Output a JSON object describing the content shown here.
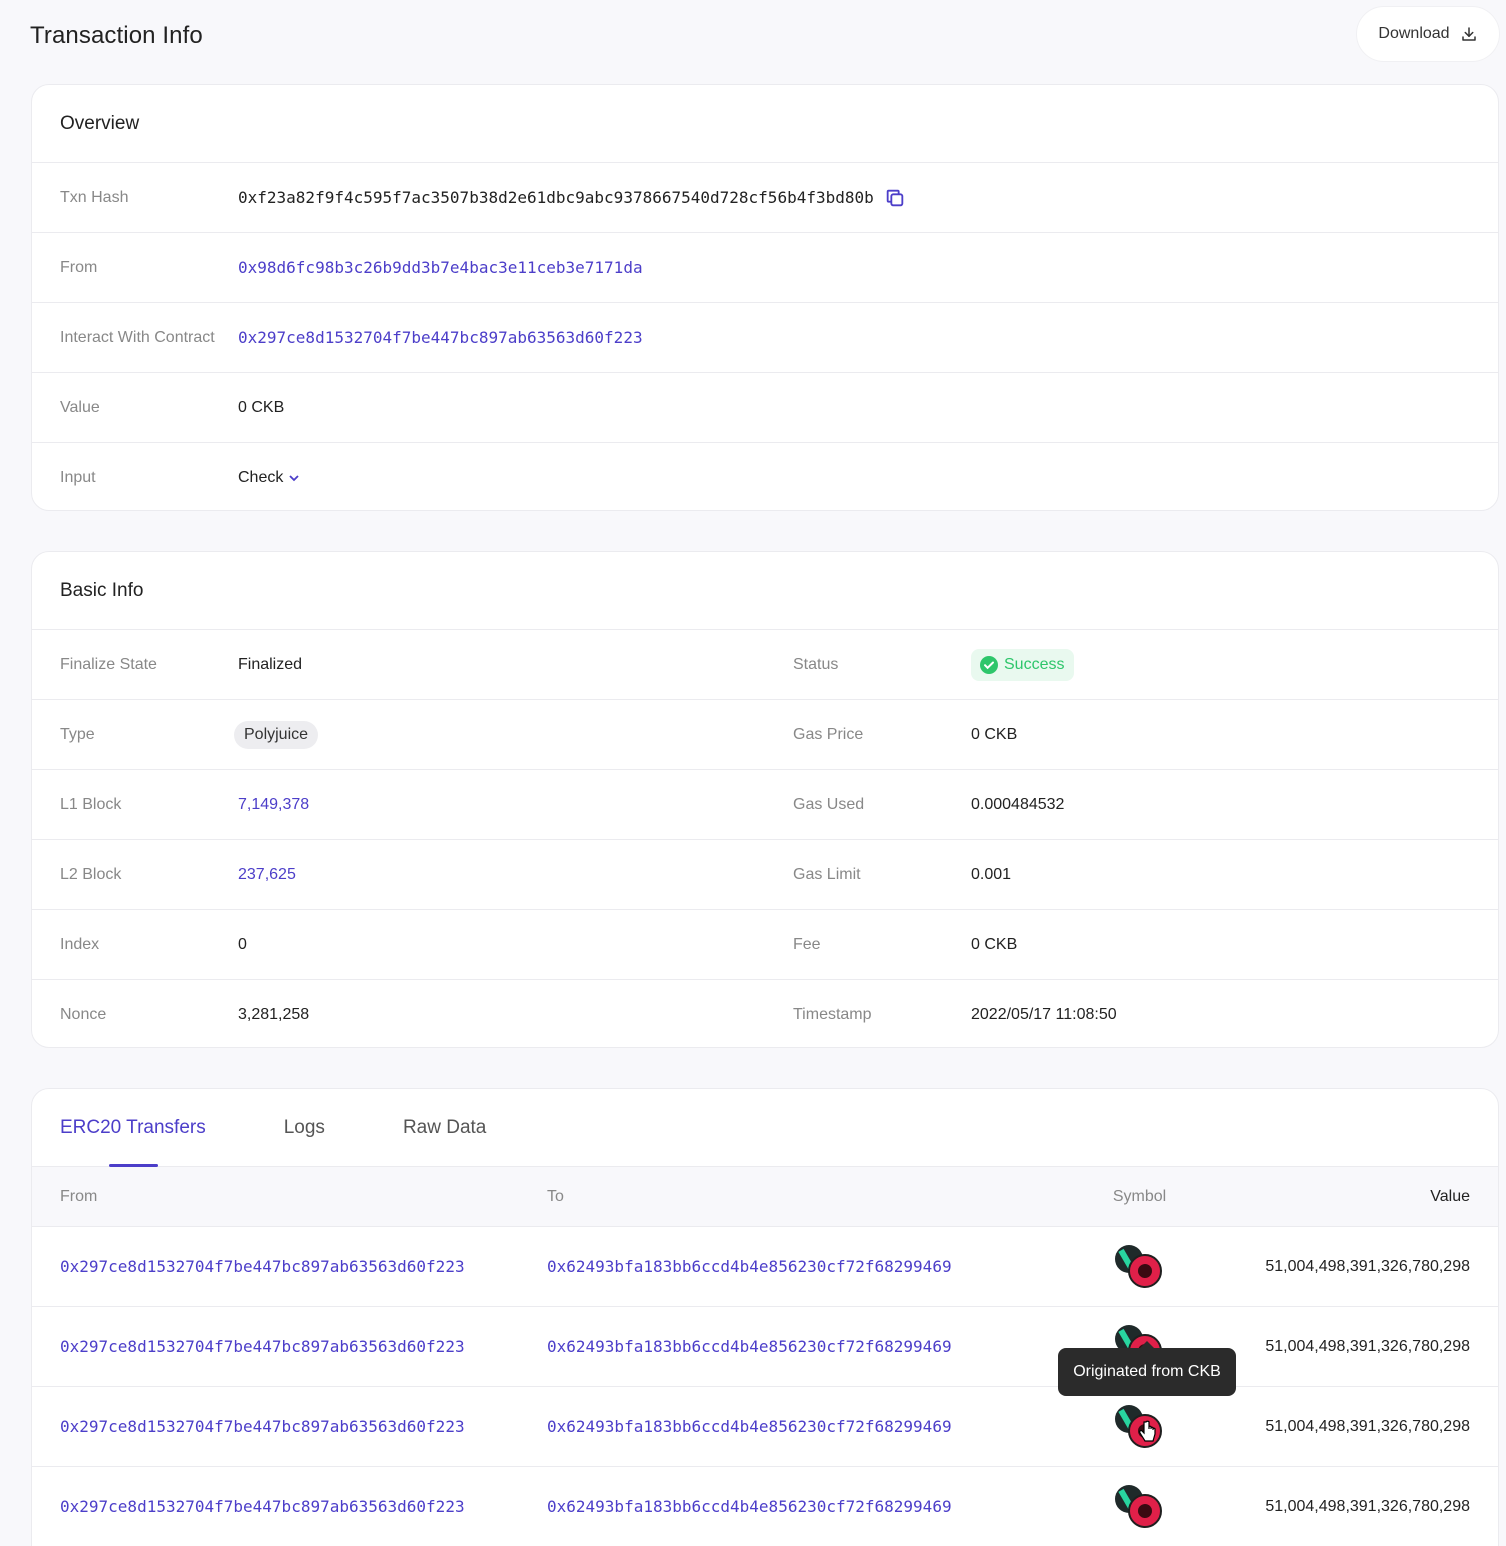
{
  "header": {
    "title": "Transaction Info",
    "download_label": "Download"
  },
  "overview": {
    "title": "Overview",
    "rows": {
      "txn_hash": {
        "label": "Txn Hash",
        "value": "0xf23a82f9f4c595f7ac3507b38d2e61dbc9abc9378667540d728cf56b4f3bd80b"
      },
      "from": {
        "label": "From",
        "value": "0x98d6fc98b3c26b9dd3b7e4bac3e11ceb3e7171da"
      },
      "contract": {
        "label": "Interact With Contract",
        "value": "0x297ce8d1532704f7be447bc897ab63563d60f223"
      },
      "value": {
        "label": "Value",
        "value": "0 CKB"
      },
      "input": {
        "label": "Input",
        "value": "Check"
      }
    }
  },
  "basic_info": {
    "title": "Basic Info",
    "left": [
      {
        "label": "Finalize State",
        "value": "Finalized"
      },
      {
        "label": "Type",
        "value": "Polyjuice"
      },
      {
        "label": "L1 Block",
        "value": "7,149,378"
      },
      {
        "label": "L2 Block",
        "value": "237,625"
      },
      {
        "label": "Index",
        "value": "0"
      },
      {
        "label": "Nonce",
        "value": "3,281,258"
      }
    ],
    "right": [
      {
        "label": "Status",
        "value": "Success"
      },
      {
        "label": "Gas Price",
        "value": "0 CKB"
      },
      {
        "label": "Gas Used",
        "value": "0.000484532"
      },
      {
        "label": "Gas Limit",
        "value": "0.001"
      },
      {
        "label": "Fee",
        "value": "0 CKB"
      },
      {
        "label": "Timestamp",
        "value": "2022/05/17 11:08:50"
      }
    ],
    "status_color": "#2ec66b"
  },
  "transfers": {
    "tabs": [
      {
        "label": "ERC20 Transfers",
        "active": true
      },
      {
        "label": "Logs",
        "active": false
      },
      {
        "label": "Raw Data",
        "active": false
      }
    ],
    "columns": {
      "from": "From",
      "to": "To",
      "symbol": "Symbol",
      "value": "Value"
    },
    "rows": [
      {
        "from": "0x297ce8d1532704f7be447bc897ab63563d60f223",
        "to": "0x62493bfa183bb6ccd4b4e856230cf72f68299469",
        "symbol_icon": "token-pair-icon",
        "value": "51,004,498,391,326,780,298"
      },
      {
        "from": "0x297ce8d1532704f7be447bc897ab63563d60f223",
        "to": "0x62493bfa183bb6ccd4b4e856230cf72f68299469",
        "symbol_icon": "token-pair-icon",
        "value": "51,004,498,391,326,780,298"
      },
      {
        "from": "0x297ce8d1532704f7be447bc897ab63563d60f223",
        "to": "0x62493bfa183bb6ccd4b4e856230cf72f68299469",
        "symbol_icon": "token-pair-icon",
        "value": "51,004,498,391,326,780,298"
      },
      {
        "from": "0x297ce8d1532704f7be447bc897ab63563d60f223",
        "to": "0x62493bfa183bb6ccd4b4e856230cf72f68299469",
        "symbol_icon": "token-pair-icon",
        "value": "51,004,498,391,326,780,298"
      }
    ],
    "tooltip": "Originated from CKB"
  },
  "colors": {
    "accent": "#4c3ec9",
    "success": "#2ec66b",
    "token_red": "#e02049"
  }
}
